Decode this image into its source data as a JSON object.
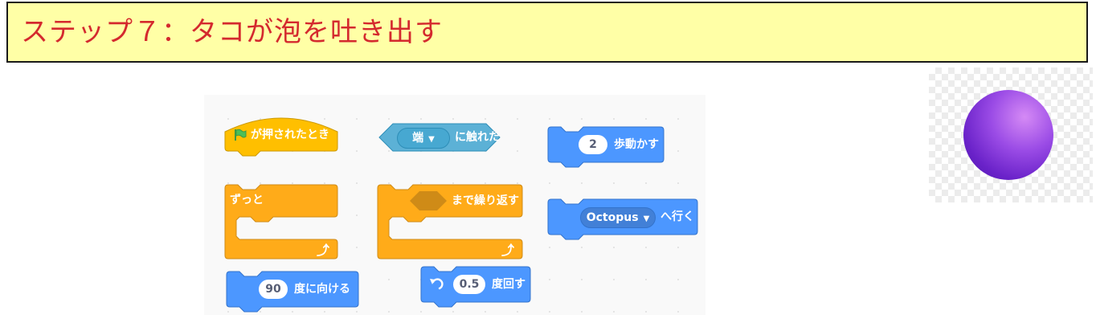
{
  "banner": {
    "title": "ステップ７：タコが泡を吐き出す"
  },
  "blocks": {
    "flag_clicked": {
      "label": "が押されたとき"
    },
    "touching": {
      "dropdown": "端",
      "label": "に触れた"
    },
    "move": {
      "value": "2",
      "label": "歩動かす"
    },
    "forever": {
      "label": "ずっと"
    },
    "repeat_until": {
      "label": "まで繰り返す"
    },
    "goto": {
      "dropdown": "Octopus",
      "label": "へ行く"
    },
    "point_direction": {
      "value": "90",
      "label": "度に向ける"
    },
    "turn": {
      "value": "0.5",
      "label": "度回す"
    }
  },
  "colors": {
    "events": "#ffbf00",
    "control": "#ffab19",
    "motion": "#4c97ff",
    "sensing": "#5cb1d6",
    "flag": "#4cbf56",
    "title_text": "#d4292e",
    "banner_bg": "#ffffa6"
  },
  "icons": {
    "flag": "green-flag-icon",
    "dropdown": "caret-down-icon",
    "loop": "loop-arrow-icon",
    "turn": "rotate-left-icon"
  }
}
